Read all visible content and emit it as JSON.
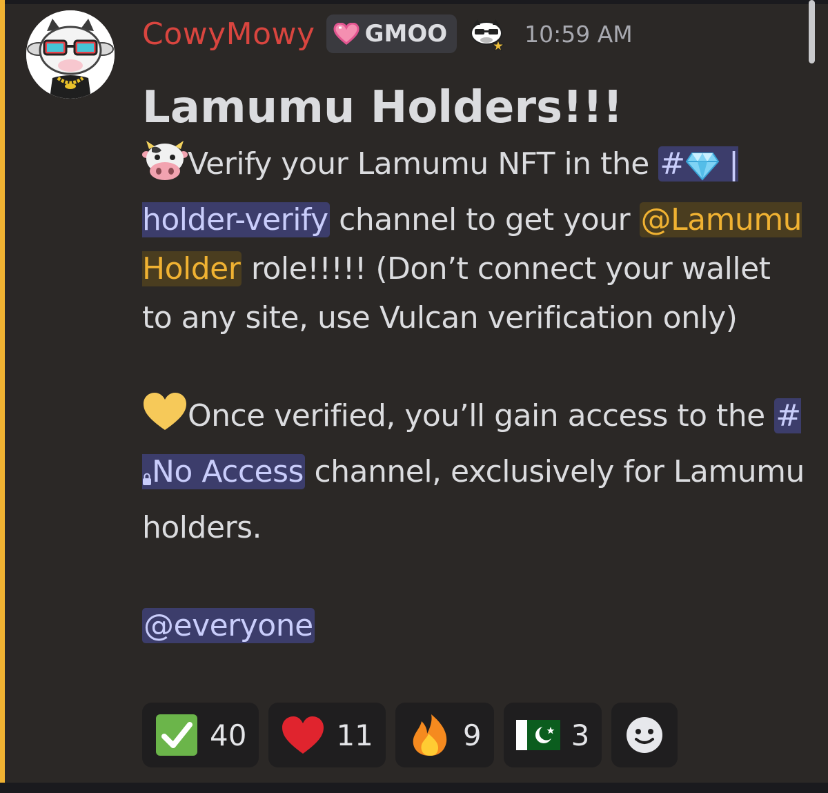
{
  "message": {
    "author": "CowyMowy",
    "role_tag": "GMOO",
    "timestamp": "10:59 AM",
    "title": "Lamumu Holders!!!",
    "p1": {
      "t1": "Verify your Lamumu NFT in the ",
      "channel1_hash": "#",
      "channel1_sep": " | ",
      "channel1_name": "holder-verify",
      "t2": " channel to get your ",
      "role_mention": "@Lamumu Holder",
      "t3": " role!!!!! (Don’t connect your wallet to any site, use Vulcan verification only)"
    },
    "p2": {
      "t1": "Once verified, you’ll gain access to the ",
      "channel2_hash": "#",
      "channel2_name": "No Access",
      "t2": " channel, exclusively for Lamumu holders."
    },
    "everyone_mention": "@everyone"
  },
  "reactions": [
    {
      "emoji": "check-mark-emoji",
      "count": "40"
    },
    {
      "emoji": "red-heart-emoji",
      "count": "11"
    },
    {
      "emoji": "fire-emoji",
      "count": "9"
    },
    {
      "emoji": "pakistan-flag-emoji",
      "count": "3"
    }
  ],
  "colors": {
    "background": "#2b2826",
    "mention_bar": "#f0b232",
    "username": "#d9453f",
    "mention_bg": "#3c3d6b",
    "mention_text": "#c9cdfb",
    "role_text": "#f0b232"
  }
}
